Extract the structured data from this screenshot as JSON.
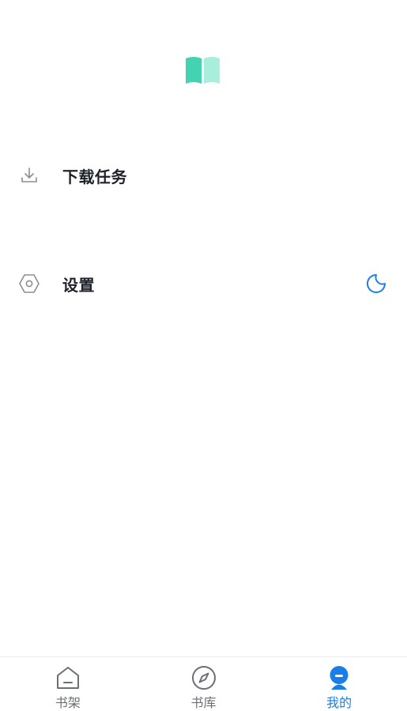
{
  "header": {
    "logo_icon": "open-book-icon",
    "logo_colors": [
      "#44d3b2",
      "#a8eedc"
    ]
  },
  "menu": {
    "download": {
      "label": "下载任务",
      "icon": "download-icon"
    },
    "settings": {
      "label": "设置",
      "icon": "hexagon-settings-icon",
      "night_toggle_icon": "moon-icon"
    }
  },
  "tabbar": {
    "active_color": "#1a7ee8",
    "inactive_color": "#6b6f76",
    "tabs": [
      {
        "label": "书架",
        "icon": "bookshelf-home-icon",
        "active": false
      },
      {
        "label": "书库",
        "icon": "compass-icon",
        "active": false
      },
      {
        "label": "我的",
        "icon": "user-profile-icon",
        "active": true
      }
    ]
  }
}
